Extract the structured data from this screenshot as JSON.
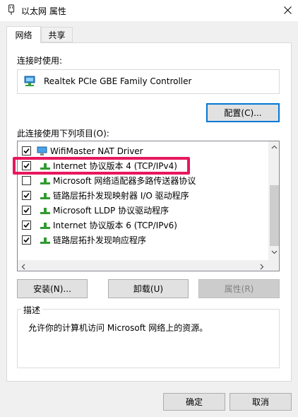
{
  "window": {
    "title": "以太网 属性"
  },
  "tabs": [
    {
      "label": "网络"
    },
    {
      "label": "共享"
    }
  ],
  "connect_using": {
    "label": "连接时使用:",
    "adapter": "Realtek PCIe GBE Family Controller",
    "configure_button": "配置(C)..."
  },
  "items_section": {
    "label": "此连接使用下列项目(O):",
    "items": [
      {
        "label": "WifiMaster NAT Driver",
        "checked": true
      },
      {
        "label": "Internet 协议版本 4 (TCP/IPv4)",
        "checked": true
      },
      {
        "label": "Microsoft 网络适配器多路传送器协议",
        "checked": false
      },
      {
        "label": "链路层拓扑发现映射器 I/O 驱动程序",
        "checked": true
      },
      {
        "label": "Microsoft LLDP 协议驱动程序",
        "checked": true
      },
      {
        "label": "Internet 协议版本 6 (TCP/IPv6)",
        "checked": true
      },
      {
        "label": "链路层拓扑发现响应程序",
        "checked": true
      }
    ]
  },
  "buttons": {
    "install": "安装(N)...",
    "uninstall": "卸载(U)",
    "properties": "属性(R)"
  },
  "description": {
    "title": "描述",
    "text": "允许你的计算机访问 Microsoft 网络上的资源。"
  },
  "footer": {
    "ok": "确定",
    "cancel": "取消"
  },
  "colors": {
    "highlight": "#e8175d",
    "focus": "#0078d7"
  }
}
